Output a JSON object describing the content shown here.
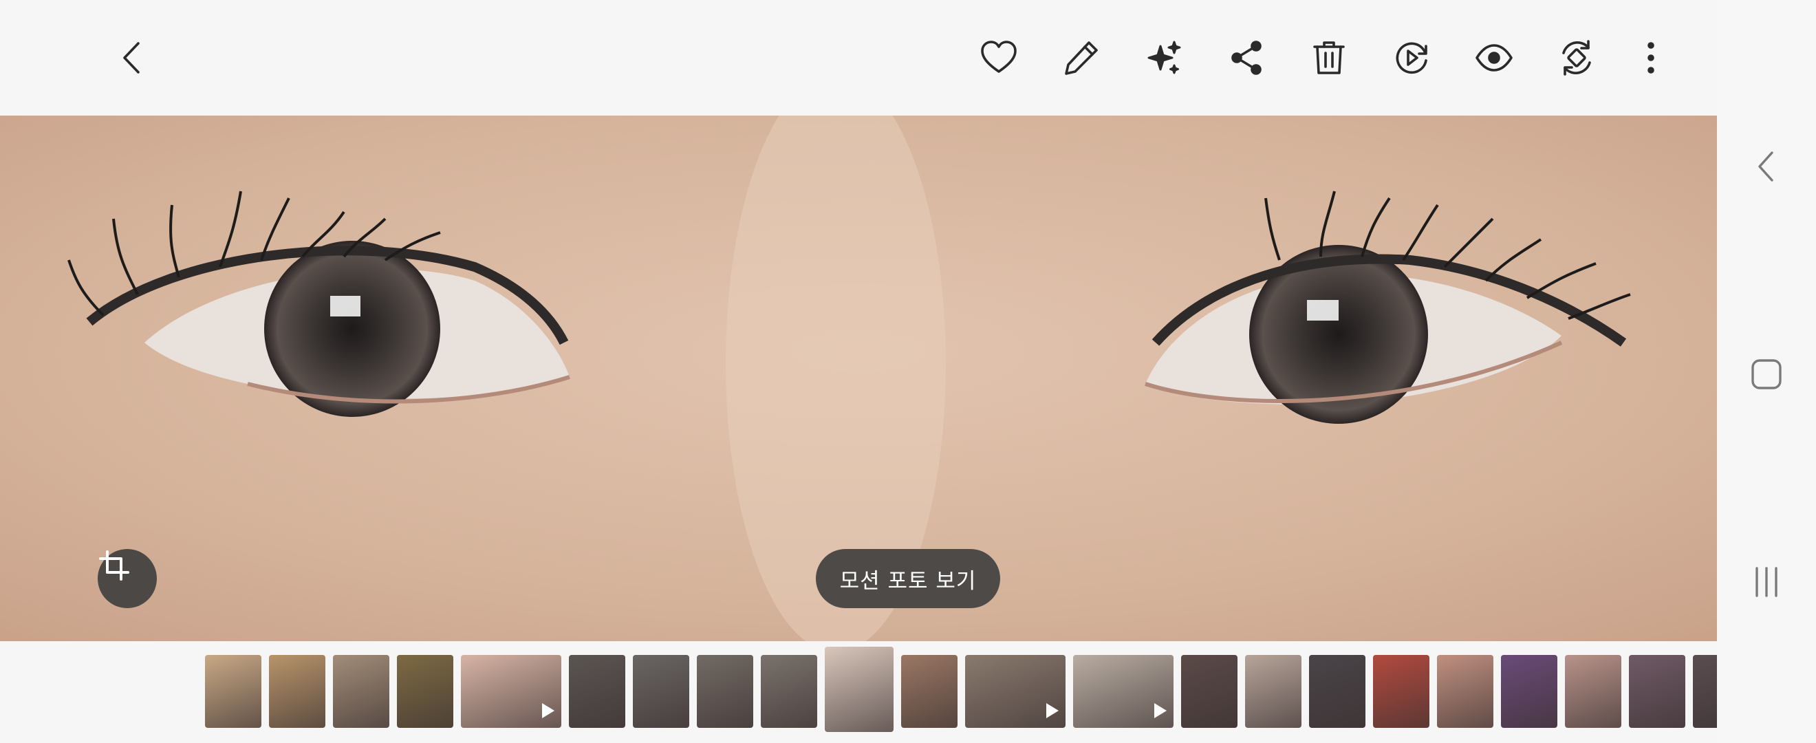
{
  "toolbar": {
    "back": "back-icon",
    "actions": [
      "heart-icon",
      "pencil-icon",
      "sparkle-icon",
      "share-icon",
      "trash-icon",
      "motion-play-icon",
      "eye-icon",
      "rotate-icon",
      "more-icon"
    ]
  },
  "photo": {
    "motion_photo_label": "모션 포토 보기",
    "crop_icon": "crop-icon"
  },
  "navbar": {
    "items": [
      "back-nav-icon",
      "home-nav-icon",
      "recents-nav-icon"
    ]
  },
  "filmstrip": {
    "thumbnails": [
      {
        "kind": "photo",
        "color": "#c9a985"
      },
      {
        "kind": "photo",
        "color": "#b8946a"
      },
      {
        "kind": "photo",
        "color": "#a28d78"
      },
      {
        "kind": "photo",
        "color": "#7d6a43"
      },
      {
        "kind": "video",
        "color": "#d7b4a5"
      },
      {
        "kind": "photo",
        "color": "#5b5552"
      },
      {
        "kind": "photo",
        "color": "#6a6562"
      },
      {
        "kind": "photo",
        "color": "#726a64"
      },
      {
        "kind": "photo",
        "color": "#7a726c"
      },
      {
        "kind": "photo",
        "color": "#d9c7bb",
        "current": true
      },
      {
        "kind": "photo",
        "color": "#9a7763"
      },
      {
        "kind": "video",
        "color": "#8a7a6e"
      },
      {
        "kind": "video",
        "color": "#b9ada2"
      },
      {
        "kind": "photo",
        "color": "#5a4a48"
      },
      {
        "kind": "photo",
        "color": "#b7a59a"
      },
      {
        "kind": "photo",
        "color": "#4a4448"
      },
      {
        "kind": "photo",
        "color": "#b24a3e"
      },
      {
        "kind": "photo",
        "color": "#c09080"
      },
      {
        "kind": "photo",
        "color": "#6a4a78"
      },
      {
        "kind": "photo",
        "color": "#b8938a"
      },
      {
        "kind": "photo",
        "color": "#6f5a66"
      },
      {
        "kind": "photo",
        "color": "#5a4d50"
      }
    ]
  }
}
